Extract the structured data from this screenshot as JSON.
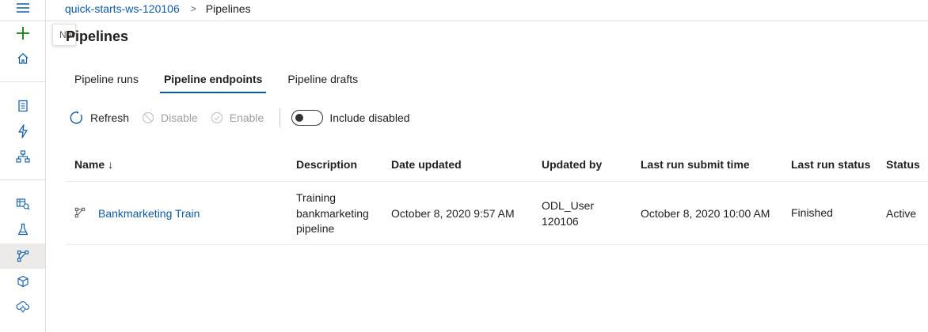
{
  "nav": {
    "items": [
      {
        "name": "hamburger-menu-icon"
      },
      {
        "name": "create-new-plus-icon"
      },
      {
        "name": "home-icon"
      },
      {
        "name": "notebooks-icon"
      },
      {
        "name": "automated-ml-icon"
      },
      {
        "name": "designer-icon"
      },
      {
        "name": "datasets-icon"
      },
      {
        "name": "experiments-icon"
      },
      {
        "name": "pipelines-icon"
      },
      {
        "name": "models-icon"
      },
      {
        "name": "endpoints-icon"
      }
    ],
    "accent": "#0f5aa3",
    "plus_color": "#107c10"
  },
  "tooltip_stub": "New",
  "breadcrumb": {
    "workspace": "quick-starts-ws-120106",
    "separator": ">",
    "current": "Pipelines"
  },
  "page": {
    "title": "Pipelines"
  },
  "tabs": [
    {
      "label": "Pipeline runs",
      "active": false
    },
    {
      "label": "Pipeline endpoints",
      "active": true
    },
    {
      "label": "Pipeline drafts",
      "active": false
    }
  ],
  "toolbar": {
    "refresh": "Refresh",
    "disable": "Disable",
    "enable": "Enable",
    "include_disabled": "Include disabled",
    "include_disabled_on": false
  },
  "table": {
    "columns": {
      "name": "Name",
      "sort_indicator": "↓",
      "description": "Description",
      "date_updated": "Date updated",
      "updated_by": "Updated by",
      "last_run_submit_time": "Last run submit time",
      "last_run_status": "Last run status",
      "status": "Status"
    },
    "rows": [
      {
        "name": "Bankmarketing Train",
        "description_lines": [
          "Training",
          "bankmarketing",
          "pipeline"
        ],
        "date_updated": "October 8, 2020 9:57 AM",
        "updated_by_lines": [
          "ODL_User",
          "120106"
        ],
        "last_run_submit_time": "October 8, 2020 10:00 AM",
        "last_run_status": "Finished",
        "status": "Active"
      }
    ]
  }
}
